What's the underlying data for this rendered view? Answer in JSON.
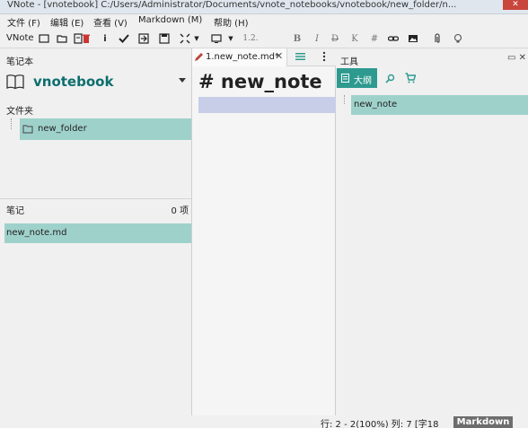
{
  "window": {
    "title": "VNote - [vnotebook] C:/Users/Administrator/Documents/vnote_notebooks/vnotebook/new_folder/n...",
    "close_glyph": "✕"
  },
  "menubar": {
    "items": [
      "文件 (F)",
      "编辑 (E)",
      "查看 (V)",
      "Markdown (M)",
      "帮助 (H)"
    ]
  },
  "toolbar": {
    "app_label": "VNote",
    "icons": [
      "new-note-icon",
      "open-folder-icon",
      "save-icon",
      "delete-icon",
      "info-icon",
      "check-icon",
      "export-icon",
      "floppy-icon",
      "expand-icon",
      "dropdown-caret-icon",
      "monitor-icon",
      "dropdown-caret-icon"
    ],
    "headings_label": "1.2.",
    "bold": "B",
    "italic": "I",
    "strike": "D",
    "k_label": "K",
    "hash": "#",
    "grid": "#"
  },
  "left_panel": {
    "header": "笔记本",
    "notebook_name": "vnotebook",
    "folders_header": "文件夹",
    "folders": [
      "new_folder"
    ],
    "notes_header": "笔记",
    "notes_count": "0 项",
    "notes": [
      "new_note.md"
    ]
  },
  "editor": {
    "tab_label": "1.new_note.md*",
    "tab_close": "✕",
    "content_heading": "# new_note"
  },
  "right_panel": {
    "header": "工具",
    "outline_tab": "大纲",
    "outline_items": [
      "new_note"
    ]
  },
  "statusbar": {
    "position": "行: 2 - 2(100%) 列: 7 [字18",
    "mode": "Markdown"
  },
  "colors": {
    "selection": "#9fd1cb",
    "accent": "#2e9a8f",
    "notebook_text": "#0d6e6e",
    "current_line": "#c8cde8"
  }
}
